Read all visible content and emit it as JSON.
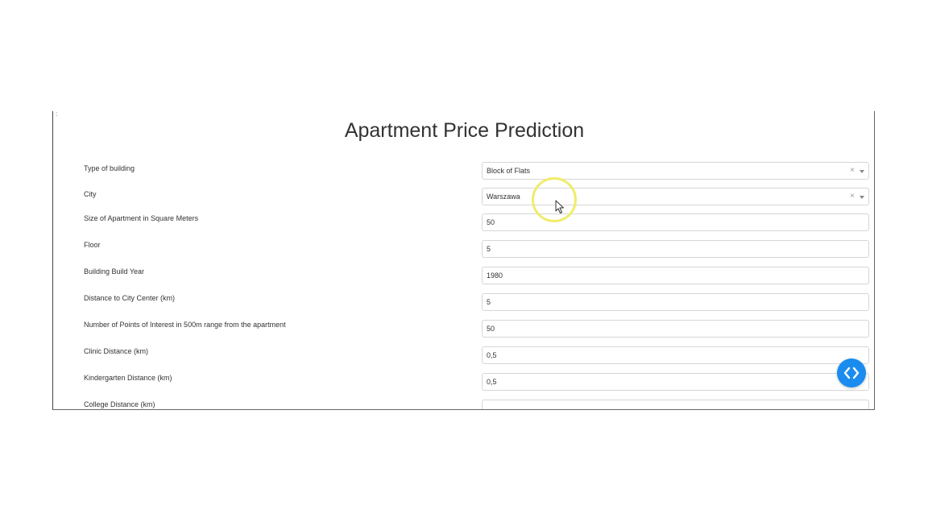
{
  "page": {
    "title": "Apartment Price Prediction"
  },
  "form": {
    "fields": [
      {
        "label": "Type of building",
        "value": "Block of Flats",
        "kind": "select"
      },
      {
        "label": "City",
        "value": "Warszawa",
        "kind": "select"
      },
      {
        "label": "Size of Apartment in Square Meters",
        "value": "50",
        "kind": "input"
      },
      {
        "label": "Floor",
        "value": "5",
        "kind": "input"
      },
      {
        "label": "Building Build Year",
        "value": "1980",
        "kind": "input"
      },
      {
        "label": "Distance to City Center (km)",
        "value": "5",
        "kind": "input"
      },
      {
        "label": "Number of Points of Interest in 500m range from the apartment",
        "value": "50",
        "kind": "input"
      },
      {
        "label": "Clinic Distance (km)",
        "value": "0,5",
        "kind": "input"
      },
      {
        "label": "Kindergarten Distance (km)",
        "value": "0,5",
        "kind": "input"
      },
      {
        "label": "College Distance (km)",
        "value": "",
        "kind": "input"
      }
    ],
    "clear_symbol": "×"
  },
  "colors": {
    "accent": "#1a8cf0",
    "highlight": "#f0ec6a"
  },
  "icons": {
    "nav_button": "code-brackets-icon",
    "cursor": "mouse-pointer-icon",
    "clear": "clear-icon",
    "dropdown": "chevron-down-icon"
  }
}
